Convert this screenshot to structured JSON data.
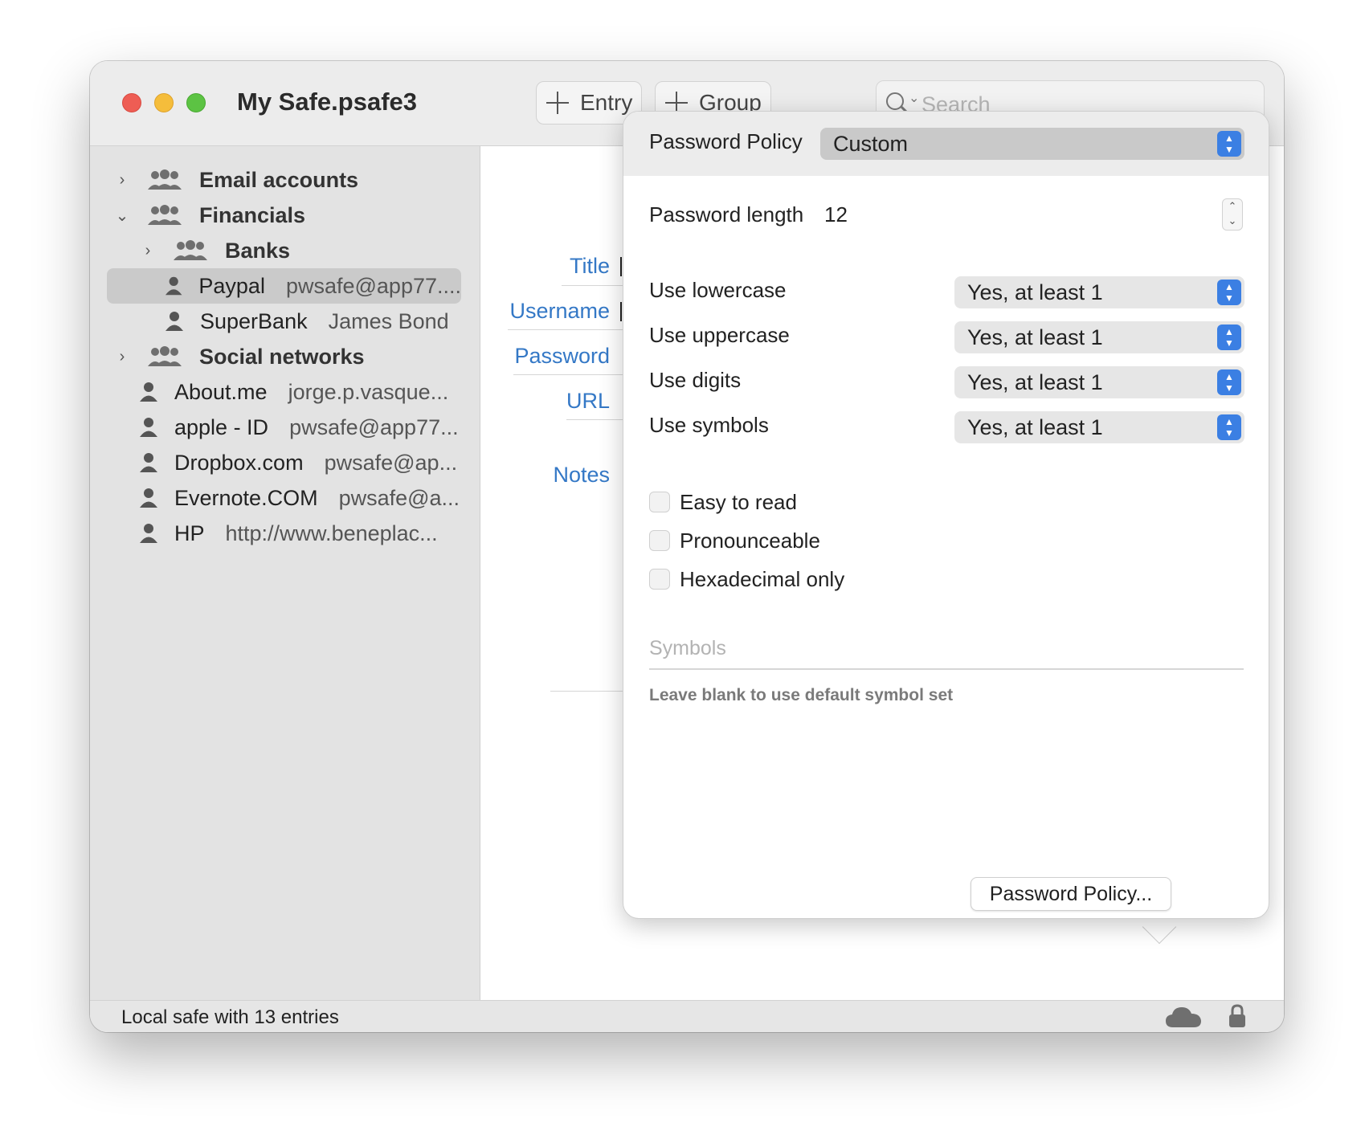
{
  "window": {
    "title": "My Safe.psafe3"
  },
  "toolbar": {
    "entry_label": "Entry",
    "group_label": "Group",
    "search_placeholder": "Search"
  },
  "sidebar": {
    "groups": {
      "email": "Email accounts",
      "financials": "Financials",
      "banks": "Banks",
      "social": "Social networks"
    },
    "entries": [
      {
        "title": "Paypal",
        "subtitle": "pwsafe@app77...."
      },
      {
        "title": "SuperBank",
        "subtitle": "James Bond"
      },
      {
        "title": "About.me",
        "subtitle": "jorge.p.vasque..."
      },
      {
        "title": "apple - ID",
        "subtitle": "pwsafe@app77..."
      },
      {
        "title": "Dropbox.com",
        "subtitle": "pwsafe@ap..."
      },
      {
        "title": "Evernote.COM",
        "subtitle": "pwsafe@a..."
      },
      {
        "title": "HP",
        "subtitle": "http://www.beneplac..."
      }
    ]
  },
  "detail": {
    "title_label": "Title",
    "username_label": "Username",
    "password_label": "Password",
    "url_label": "URL",
    "notes_label": "Notes",
    "policy_button": "Password Policy..."
  },
  "policy": {
    "policy_label": "Password Policy",
    "policy_value": "Custom",
    "length_label": "Password length",
    "length_value": "12",
    "rules": [
      {
        "label": "Use lowercase",
        "value": "Yes, at least 1"
      },
      {
        "label": "Use uppercase",
        "value": "Yes, at least 1"
      },
      {
        "label": "Use digits",
        "value": "Yes, at least 1"
      },
      {
        "label": "Use symbols",
        "value": "Yes, at least 1"
      }
    ],
    "options": [
      {
        "label": "Easy to read",
        "checked": false
      },
      {
        "label": "Pronounceable",
        "checked": false
      },
      {
        "label": "Hexadecimal only",
        "checked": false
      }
    ],
    "symbols_placeholder": "Symbols",
    "symbols_hint": "Leave blank to use default symbol set"
  },
  "status": {
    "text": "Local safe with 13 entries"
  },
  "icons": [
    "search-icon",
    "plus-icon",
    "chevron-right-icon",
    "chevron-down-icon",
    "group-icon",
    "person-icon",
    "cloud-icon",
    "lock-icon"
  ],
  "colors": {
    "accent": "#3478c6",
    "select_arrows": "#3b7fe3",
    "selection": "#cacaca"
  }
}
